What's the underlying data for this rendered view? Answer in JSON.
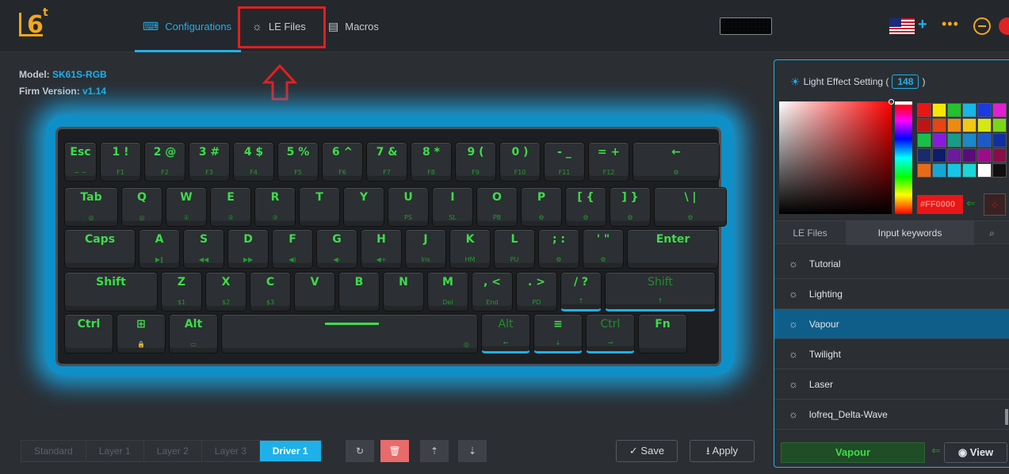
{
  "topbar": {
    "logo_text": "6",
    "nav": {
      "configurations": "Configurations",
      "le_files": "LE Files",
      "macros": "Macros"
    },
    "icons": {
      "configurations": "keyboard-icon",
      "le_files": "lightbulb-icon",
      "macros": "document-icon"
    },
    "plus": "+",
    "dots": "•••"
  },
  "device": {
    "model_label": "Model:",
    "model_value": "SK61S-RGB",
    "firm_label": "Firm Version:",
    "firm_value": "v1.14"
  },
  "keyboard": {
    "rows": [
      [
        {
          "t": "Esc",
          "b": "~ ~"
        },
        {
          "t": "1 !",
          "b": "F1"
        },
        {
          "t": "2 @",
          "b": "F2"
        },
        {
          "t": "3 #",
          "b": "F3"
        },
        {
          "t": "4 $",
          "b": "F4"
        },
        {
          "t": "5 %",
          "b": "F5"
        },
        {
          "t": "6 ^",
          "b": "F6"
        },
        {
          "t": "7 &",
          "b": "F7"
        },
        {
          "t": "8 *",
          "b": "F8"
        },
        {
          "t": "9 (",
          "b": "F9"
        },
        {
          "t": "0 )",
          "b": "F10"
        },
        {
          "t": "- _",
          "b": "F11"
        },
        {
          "t": "= +",
          "b": "F12"
        },
        {
          "t": "←",
          "b": "⚙"
        }
      ],
      [
        {
          "t": "Tab",
          "b": "◎"
        },
        {
          "t": "Q",
          "b": "◎"
        },
        {
          "t": "W",
          "b": "①"
        },
        {
          "t": "E",
          "b": "②"
        },
        {
          "t": "R",
          "b": "③"
        },
        {
          "t": "T",
          "b": ""
        },
        {
          "t": "Y",
          "b": ""
        },
        {
          "t": "U",
          "b": "PS"
        },
        {
          "t": "I",
          "b": "SL"
        },
        {
          "t": "O",
          "b": "PB"
        },
        {
          "t": "P",
          "b": "⚙"
        },
        {
          "t": "[ {",
          "b": "⚙"
        },
        {
          "t": "] }",
          "b": "⚙"
        },
        {
          "t": "\\ |",
          "b": "⚙"
        }
      ],
      [
        {
          "t": "Caps",
          "b": ""
        },
        {
          "t": "A",
          "b": "▶‖"
        },
        {
          "t": "S",
          "b": "◀◀"
        },
        {
          "t": "D",
          "b": "▶▶"
        },
        {
          "t": "F",
          "b": "◀)"
        },
        {
          "t": "G",
          "b": "◀-"
        },
        {
          "t": "H",
          "b": "◀+"
        },
        {
          "t": "J",
          "b": "Ins"
        },
        {
          "t": "K",
          "b": "HM"
        },
        {
          "t": "L",
          "b": "PU"
        },
        {
          "t": "; :",
          "b": "⚙"
        },
        {
          "t": "' \"",
          "b": "⚙"
        },
        {
          "t": "Enter",
          "b": ""
        }
      ],
      [
        {
          "t": "Shift",
          "b": ""
        },
        {
          "t": "Z",
          "b": "$1"
        },
        {
          "t": "X",
          "b": "$2"
        },
        {
          "t": "C",
          "b": "$3"
        },
        {
          "t": "V",
          "b": ""
        },
        {
          "t": "B",
          "b": ""
        },
        {
          "t": "N",
          "b": ""
        },
        {
          "t": "M",
          "b": "Del"
        },
        {
          "t": ", <",
          "b": "End"
        },
        {
          "t": ". >",
          "b": "PD"
        },
        {
          "t": "/ ?",
          "b": "↑"
        },
        {
          "t": "Shift",
          "b": "↑"
        }
      ],
      [
        {
          "t": "Ctrl",
          "b": ""
        },
        {
          "t": "⊞",
          "b": "🔒"
        },
        {
          "t": "Alt",
          "b": "▭"
        },
        {
          "t": "",
          "b": "◎"
        },
        {
          "t": "Alt",
          "b": "←"
        },
        {
          "t": "≡",
          "b": "↓"
        },
        {
          "t": "Ctrl",
          "b": "→"
        },
        {
          "t": "Fn",
          "b": ""
        }
      ]
    ]
  },
  "bottom": {
    "layers": [
      "Standard",
      "Layer 1",
      "Layer 2",
      "Layer 3",
      "Driver 1"
    ],
    "active_layer": "Driver 1",
    "tools": [
      {
        "name": "reset-icon",
        "glyph": "↻"
      },
      {
        "name": "delete-icon",
        "glyph": "🗑"
      },
      {
        "name": "upload-icon",
        "glyph": "⇡"
      },
      {
        "name": "download-icon",
        "glyph": "⇣"
      }
    ],
    "save_label": "✓ Save",
    "apply_label": "⭳ Apply"
  },
  "light_panel": {
    "title": "Light Effect Setting (",
    "count": "148",
    "title_end": ")",
    "hex_value": "#FF0000",
    "swatches": [
      "#e81616",
      "#f7e600",
      "#22c22e",
      "#16b6e8",
      "#1a3be0",
      "#e020d0",
      "#c01414",
      "#e84414",
      "#ee8a12",
      "#f2c816",
      "#d6e814",
      "#7ad618",
      "#18c048",
      "#8a1ae0",
      "#1a9a8a",
      "#1a8ac8",
      "#1a5ac8",
      "#1030a0",
      "#1a2a6a",
      "#0c1c6a",
      "#6a1a9a",
      "#5a0c7a",
      "#9a0c8a",
      "#8a0c4a",
      "#e86a16",
      "#16a6d6",
      "#16c6e6",
      "#1ad6d6",
      "#ffffff",
      "#101010"
    ],
    "tabs": {
      "files": "LE Files",
      "keywords": "Input keywords"
    },
    "list": [
      "Tutorial",
      "Lighting",
      "Vapour",
      "Twilight",
      "Laser",
      "lofreq_Delta-Wave"
    ],
    "selected": "Vapour",
    "current_effect": "Vapour",
    "view_label": "◉ View"
  }
}
